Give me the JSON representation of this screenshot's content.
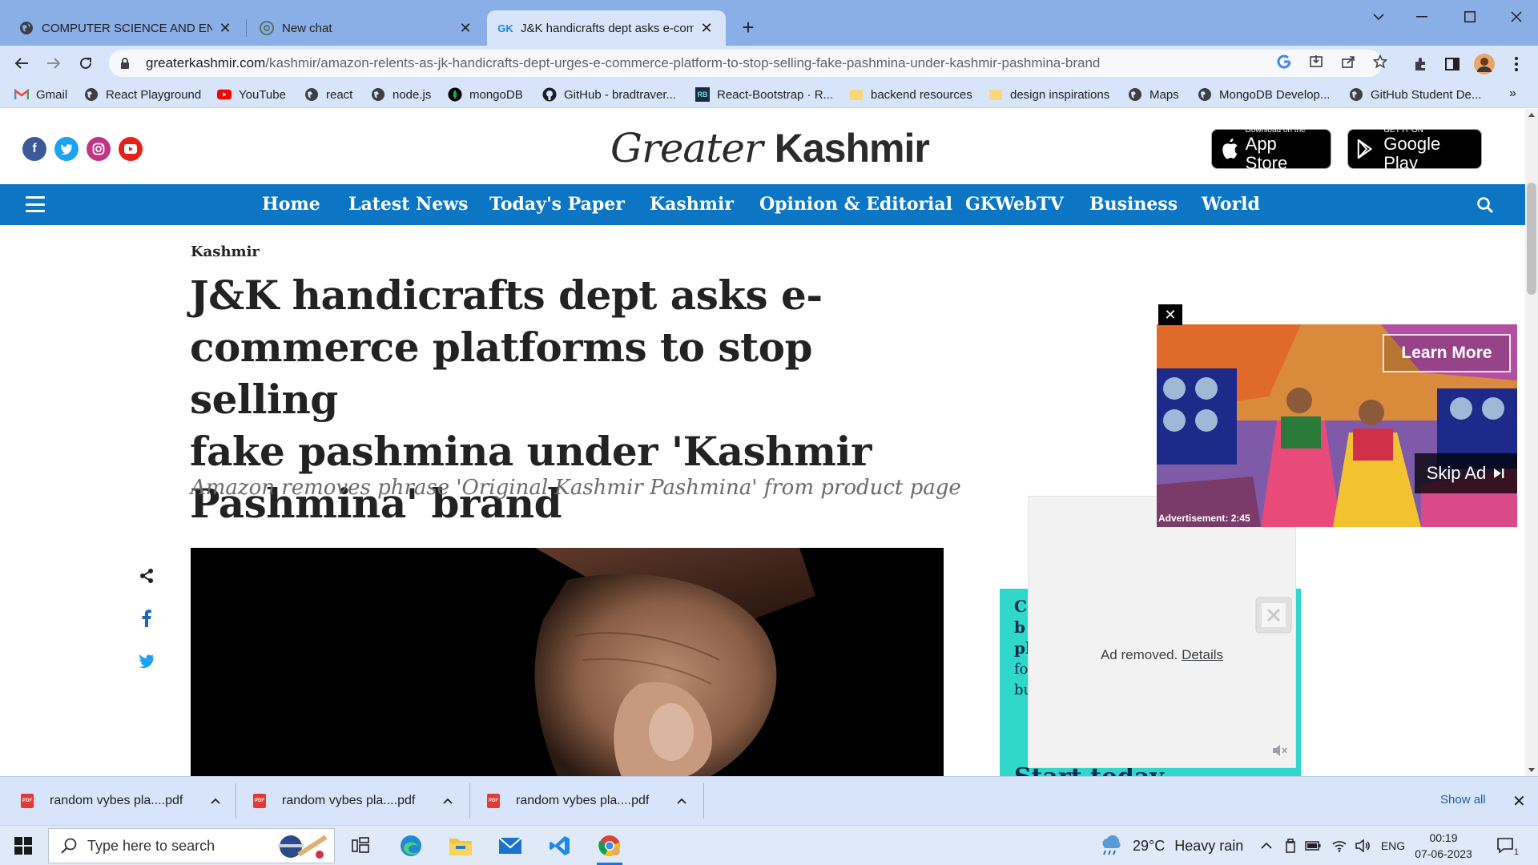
{
  "browser": {
    "tabs": [
      {
        "title": "COMPUTER SCIENCE AND ENGINEERING",
        "icon": "globe-icon"
      },
      {
        "title": "New chat",
        "icon": "chatgpt-icon"
      },
      {
        "title": "J&K handicrafts dept asks e-commerce platforms",
        "icon": "gk-icon",
        "favicon_text": "GK"
      }
    ],
    "url_domain": "greaterkashmir.com",
    "url_path": "/kashmir/amazon-relents-as-jk-handicrafts-dept-urges-e-commerce-platform-to-stop-selling-fake-pashmina-under-kashmir-pashmina-brand",
    "bookmarks": [
      {
        "label": "Gmail",
        "icon": "gmail-icon"
      },
      {
        "label": "React Playground",
        "icon": "globe-icon"
      },
      {
        "label": "YouTube",
        "icon": "youtube-icon"
      },
      {
        "label": "react",
        "icon": "globe-icon"
      },
      {
        "label": "node.js",
        "icon": "globe-icon"
      },
      {
        "label": "mongoDB",
        "icon": "mongodb-icon"
      },
      {
        "label": "GitHub - bradtraver...",
        "icon": "github-icon"
      },
      {
        "label": "React-Bootstrap · R...",
        "icon": "react-bootstrap-icon",
        "icon_text": "RB"
      },
      {
        "label": "backend resources",
        "icon": "folder-icon"
      },
      {
        "label": "design inspirations",
        "icon": "folder-icon"
      },
      {
        "label": "Maps",
        "icon": "globe-icon"
      },
      {
        "label": "MongoDB Develop...",
        "icon": "globe-icon"
      },
      {
        "label": "GitHub Student De...",
        "icon": "globe-icon"
      }
    ],
    "bookmarks_more": "»"
  },
  "site": {
    "logo_italic": "Greater",
    "logo_bold": "Kashmir",
    "social": [
      {
        "name": "facebook",
        "glyph": "f",
        "color": "#3b5998"
      },
      {
        "name": "twitter",
        "glyph": "t",
        "color": "#1da1f2"
      },
      {
        "name": "instagram",
        "glyph": "◎",
        "color": "#c13584"
      },
      {
        "name": "youtube",
        "glyph": "▶",
        "color": "#e62117"
      }
    ],
    "app_store": {
      "small": "Download on the",
      "large": "App Store"
    },
    "google_play": {
      "small": "GET IT ON",
      "large": "Google Play"
    },
    "nav": [
      "Home",
      "Latest News",
      "Today's Paper",
      "Kashmir",
      "Opinion & Editorial",
      "GKWebTV",
      "Business",
      "World"
    ],
    "accent": "#0c75c4"
  },
  "article": {
    "category": "Kashmir",
    "headline_lines": [
      "J&K handicrafts dept asks e-",
      "commerce platforms to stop selling",
      "fake pashmina under 'Kashmir",
      "Pashmina' brand"
    ],
    "subhead": "Amazon removes phrase 'Original Kashmir Pashmina' from product page"
  },
  "ads": {
    "learn_more": "Learn More",
    "skip_ad": "Skip Ad",
    "ad_label": "Advertisement: 2:45",
    "removed_text": "Ad removed.",
    "removed_link": "Details",
    "teal_fragments": [
      "C",
      "b",
      "pl",
      "fo",
      "bu"
    ],
    "teal_bottom": "Start today"
  },
  "downloads": {
    "items": [
      "random vybes pla....pdf",
      "random vybes pla....pdf",
      "random vybes pla....pdf"
    ],
    "show_all": "Show all"
  },
  "taskbar": {
    "search_placeholder": "Type here to search",
    "weather_temp": "29°C",
    "weather_desc": "Heavy rain",
    "lang": "ENG",
    "time": "00:19",
    "date": "07-06-2023",
    "notifications": "1"
  }
}
